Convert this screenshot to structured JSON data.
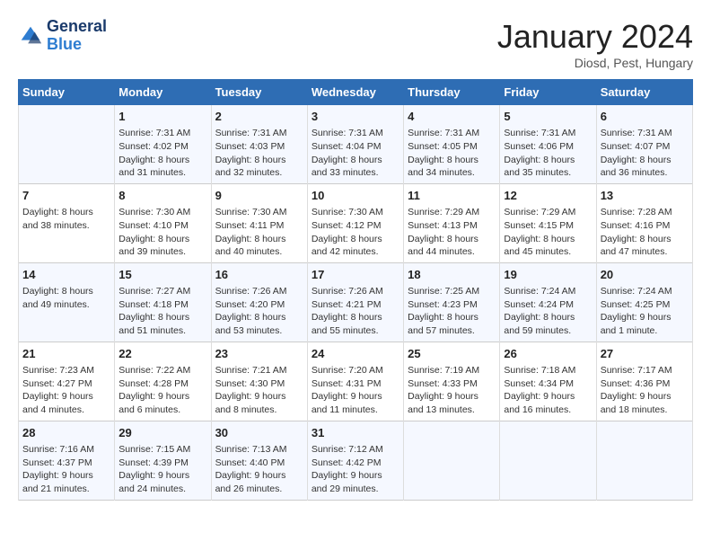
{
  "header": {
    "logo_line1": "General",
    "logo_line2": "Blue",
    "month": "January 2024",
    "location": "Diosd, Pest, Hungary"
  },
  "weekdays": [
    "Sunday",
    "Monday",
    "Tuesday",
    "Wednesday",
    "Thursday",
    "Friday",
    "Saturday"
  ],
  "weeks": [
    [
      {
        "day": "",
        "info": ""
      },
      {
        "day": "1",
        "info": "Sunrise: 7:31 AM\nSunset: 4:02 PM\nDaylight: 8 hours\nand 31 minutes."
      },
      {
        "day": "2",
        "info": "Sunrise: 7:31 AM\nSunset: 4:03 PM\nDaylight: 8 hours\nand 32 minutes."
      },
      {
        "day": "3",
        "info": "Sunrise: 7:31 AM\nSunset: 4:04 PM\nDaylight: 8 hours\nand 33 minutes."
      },
      {
        "day": "4",
        "info": "Sunrise: 7:31 AM\nSunset: 4:05 PM\nDaylight: 8 hours\nand 34 minutes."
      },
      {
        "day": "5",
        "info": "Sunrise: 7:31 AM\nSunset: 4:06 PM\nDaylight: 8 hours\nand 35 minutes."
      },
      {
        "day": "6",
        "info": "Sunrise: 7:31 AM\nSunset: 4:07 PM\nDaylight: 8 hours\nand 36 minutes."
      }
    ],
    [
      {
        "day": "7",
        "info": "Daylight: 8 hours\nand 38 minutes."
      },
      {
        "day": "8",
        "info": "Sunrise: 7:30 AM\nSunset: 4:10 PM\nDaylight: 8 hours\nand 39 minutes."
      },
      {
        "day": "9",
        "info": "Sunrise: 7:30 AM\nSunset: 4:11 PM\nDaylight: 8 hours\nand 40 minutes."
      },
      {
        "day": "10",
        "info": "Sunrise: 7:30 AM\nSunset: 4:12 PM\nDaylight: 8 hours\nand 42 minutes."
      },
      {
        "day": "11",
        "info": "Sunrise: 7:29 AM\nSunset: 4:13 PM\nDaylight: 8 hours\nand 44 minutes."
      },
      {
        "day": "12",
        "info": "Sunrise: 7:29 AM\nSunset: 4:15 PM\nDaylight: 8 hours\nand 45 minutes."
      },
      {
        "day": "13",
        "info": "Sunrise: 7:28 AM\nSunset: 4:16 PM\nDaylight: 8 hours\nand 47 minutes."
      }
    ],
    [
      {
        "day": "14",
        "info": "Daylight: 8 hours\nand 49 minutes."
      },
      {
        "day": "15",
        "info": "Sunrise: 7:27 AM\nSunset: 4:18 PM\nDaylight: 8 hours\nand 51 minutes."
      },
      {
        "day": "16",
        "info": "Sunrise: 7:26 AM\nSunset: 4:20 PM\nDaylight: 8 hours\nand 53 minutes."
      },
      {
        "day": "17",
        "info": "Sunrise: 7:26 AM\nSunset: 4:21 PM\nDaylight: 8 hours\nand 55 minutes."
      },
      {
        "day": "18",
        "info": "Sunrise: 7:25 AM\nSunset: 4:23 PM\nDaylight: 8 hours\nand 57 minutes."
      },
      {
        "day": "19",
        "info": "Sunrise: 7:24 AM\nSunset: 4:24 PM\nDaylight: 8 hours\nand 59 minutes."
      },
      {
        "day": "20",
        "info": "Sunrise: 7:24 AM\nSunset: 4:25 PM\nDaylight: 9 hours\nand 1 minute."
      }
    ],
    [
      {
        "day": "21",
        "info": "Sunrise: 7:23 AM\nSunset: 4:27 PM\nDaylight: 9 hours\nand 4 minutes."
      },
      {
        "day": "22",
        "info": "Sunrise: 7:22 AM\nSunset: 4:28 PM\nDaylight: 9 hours\nand 6 minutes."
      },
      {
        "day": "23",
        "info": "Sunrise: 7:21 AM\nSunset: 4:30 PM\nDaylight: 9 hours\nand 8 minutes."
      },
      {
        "day": "24",
        "info": "Sunrise: 7:20 AM\nSunset: 4:31 PM\nDaylight: 9 hours\nand 11 minutes."
      },
      {
        "day": "25",
        "info": "Sunrise: 7:19 AM\nSunset: 4:33 PM\nDaylight: 9 hours\nand 13 minutes."
      },
      {
        "day": "26",
        "info": "Sunrise: 7:18 AM\nSunset: 4:34 PM\nDaylight: 9 hours\nand 16 minutes."
      },
      {
        "day": "27",
        "info": "Sunrise: 7:17 AM\nSunset: 4:36 PM\nDaylight: 9 hours\nand 18 minutes."
      }
    ],
    [
      {
        "day": "28",
        "info": "Sunrise: 7:16 AM\nSunset: 4:37 PM\nDaylight: 9 hours\nand 21 minutes."
      },
      {
        "day": "29",
        "info": "Sunrise: 7:15 AM\nSunset: 4:39 PM\nDaylight: 9 hours\nand 24 minutes."
      },
      {
        "day": "30",
        "info": "Sunrise: 7:13 AM\nSunset: 4:40 PM\nDaylight: 9 hours\nand 26 minutes."
      },
      {
        "day": "31",
        "info": "Sunrise: 7:12 AM\nSunset: 4:42 PM\nDaylight: 9 hours\nand 29 minutes."
      },
      {
        "day": "",
        "info": ""
      },
      {
        "day": "",
        "info": ""
      },
      {
        "day": "",
        "info": ""
      }
    ]
  ]
}
